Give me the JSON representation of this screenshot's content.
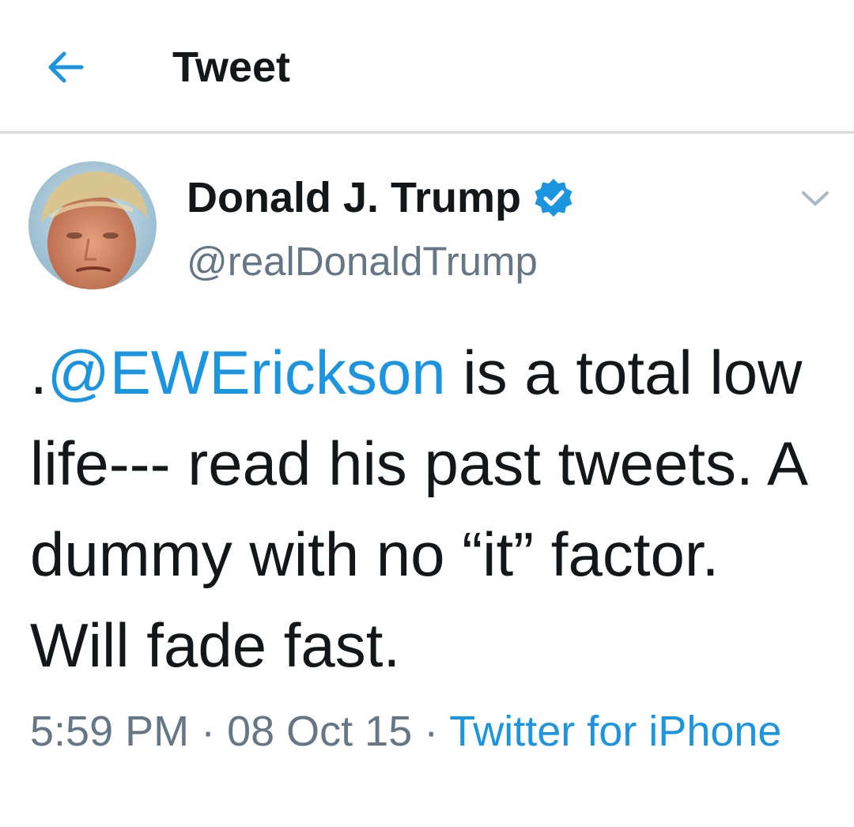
{
  "header": {
    "title": "Tweet",
    "back_icon": "arrow-left-icon"
  },
  "tweet": {
    "author": {
      "display_name": "Donald J. Trump",
      "handle": "@realDonaldTrump",
      "verified": true,
      "verified_icon": "verified-badge-icon"
    },
    "text_prefix": ".",
    "mention": "@EWErickson",
    "text_body": " is a total low life--- read his past tweets. A dummy with no “it” factor. Will fade fast.",
    "time": "5:59 PM",
    "separator": " · ",
    "date": "08 Oct 15",
    "source": "Twitter for iPhone",
    "menu_icon": "chevron-down-icon"
  },
  "colors": {
    "accent": "#1b95e0",
    "text": "#14171a",
    "secondary": "#657786",
    "divider": "#d6d9dc"
  }
}
